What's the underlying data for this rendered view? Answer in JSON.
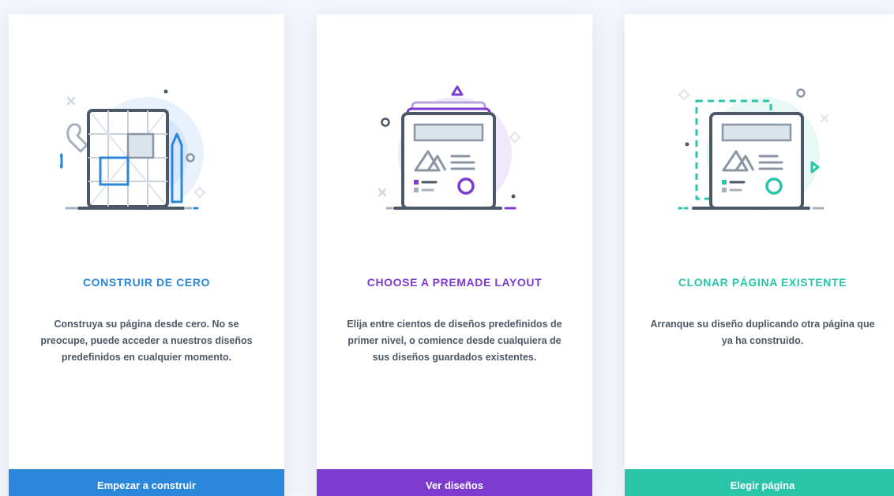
{
  "cards": [
    {
      "title": "CONSTRUIR DE CERO",
      "description": "Construya su página desde cero. No se preocupe, puede acceder a nuestros diseños predefinidos en cualquier momento.",
      "button_label": "Empezar a construir",
      "accent_color": "#2b87da",
      "icon": "build-from-scratch-illustration"
    },
    {
      "title": "CHOOSE A PREMADE LAYOUT",
      "description": "Elija entre cientos de diseños predefinidos de primer nivel, o comience desde cualquiera de sus diseños guardados existentes.",
      "button_label": "Ver diseños",
      "accent_color": "#7e3bd0",
      "icon": "premade-layout-illustration"
    },
    {
      "title": "CLONAR PÁGINA EXISTENTE",
      "description": "Arranque su diseño duplicando otra página que ya ha construido.",
      "button_label": "Elegir página",
      "accent_color": "#29c4a9",
      "icon": "clone-page-illustration"
    }
  ]
}
